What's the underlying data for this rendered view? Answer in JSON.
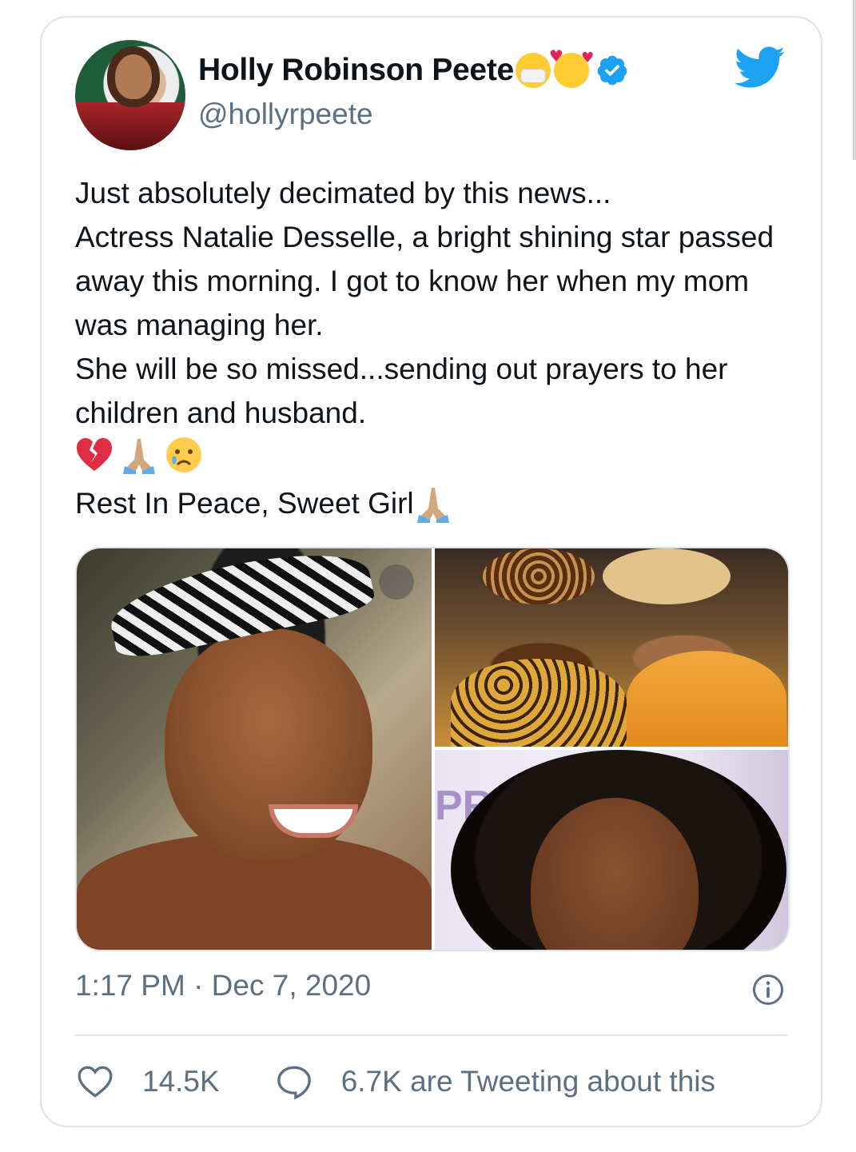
{
  "tweet": {
    "author_name": "Holly Robinson Peete",
    "author_handle": "@hollyrpeete",
    "text": "Just absolutely decimated by this news...\nActress Natalie Desselle, a bright shining star passed away this morning. I got to know her when my mom was managing her.\nShe will be so missed...sending out prayers to her children and husband.",
    "emoji_line": [
      "broken-heart",
      "folded-hands",
      "crying-face"
    ],
    "closing_line": "Rest In Peace, Sweet Girl",
    "timestamp": "1:17 PM · Dec 7, 2020",
    "likes": "14.5K",
    "tweeting_about": "6.7K are Tweeting about this",
    "photo_overlay_text": "PR"
  },
  "icons": {
    "twitter_logo": "twitter-bird-icon",
    "verified": "verified-badge-icon",
    "info": "info-icon",
    "like": "heart-outline-icon",
    "reply": "speech-bubble-icon"
  },
  "colors": {
    "brand_blue": "#1da1f2",
    "secondary_text": "#5b7083",
    "primary_text": "#0f1419",
    "border": "#dde3e8",
    "broken_heart": "#e0245e"
  }
}
